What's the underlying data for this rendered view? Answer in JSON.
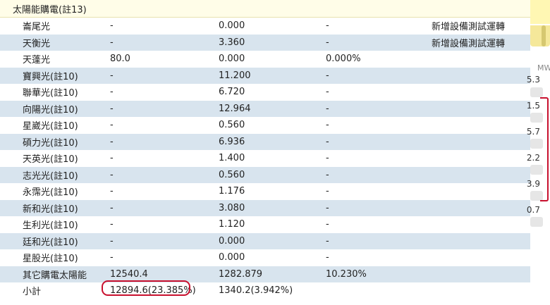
{
  "section_title": "太陽能購電(註13)",
  "rows": [
    {
      "name": "崙尾光",
      "c1": "-",
      "c2": "0.000",
      "c3": "-",
      "c4": "新增設備測試運轉",
      "alt": false
    },
    {
      "name": "天衡光",
      "c1": "-",
      "c2": "3.360",
      "c3": "-",
      "c4": "新增設備測試運轉",
      "alt": true
    },
    {
      "name": "天蓬光",
      "c1": "80.0",
      "c2": "0.000",
      "c3": "0.000%",
      "c4": "",
      "alt": false
    },
    {
      "name": "寶興光(註10)",
      "c1": "-",
      "c2": "11.200",
      "c3": "-",
      "c4": "",
      "alt": true
    },
    {
      "name": "聯華光(註10)",
      "c1": "-",
      "c2": "6.720",
      "c3": "-",
      "c4": "",
      "alt": false
    },
    {
      "name": "向陽光(註10)",
      "c1": "-",
      "c2": "12.964",
      "c3": "-",
      "c4": "",
      "alt": true
    },
    {
      "name": "星崴光(註10)",
      "c1": "-",
      "c2": "0.560",
      "c3": "-",
      "c4": "",
      "alt": false
    },
    {
      "name": "碩力光(註10)",
      "c1": "-",
      "c2": "6.936",
      "c3": "-",
      "c4": "",
      "alt": true
    },
    {
      "name": "天英光(註10)",
      "c1": "-",
      "c2": "1.400",
      "c3": "-",
      "c4": "",
      "alt": false
    },
    {
      "name": "志光光(註10)",
      "c1": "-",
      "c2": "0.560",
      "c3": "-",
      "c4": "",
      "alt": true
    },
    {
      "name": "永霈光(註10)",
      "c1": "-",
      "c2": "1.176",
      "c3": "-",
      "c4": "",
      "alt": false
    },
    {
      "name": "新和光(註10)",
      "c1": "-",
      "c2": "3.080",
      "c3": "-",
      "c4": "",
      "alt": true
    },
    {
      "name": "生利光(註10)",
      "c1": "-",
      "c2": "1.120",
      "c3": "-",
      "c4": "",
      "alt": false
    },
    {
      "name": "廷和光(註10)",
      "c1": "-",
      "c2": "0.000",
      "c3": "-",
      "c4": "",
      "alt": true
    },
    {
      "name": "星股光(註10)",
      "c1": "-",
      "c2": "0.000",
      "c3": "-",
      "c4": "",
      "alt": false
    },
    {
      "name": "其它購電太陽能",
      "c1": "12540.4",
      "c2": "1282.879",
      "c3": "10.230%",
      "c4": "",
      "alt": true
    }
  ],
  "subtotal": {
    "name": "小計",
    "c1": "12894.6(23.385%)",
    "c2": "1340.2(3.942%)"
  },
  "side_panel": {
    "unit": "MW",
    "numbers": [
      "5.3",
      "1.5",
      "5.7",
      "2.2",
      "3.9",
      "0.7"
    ]
  }
}
